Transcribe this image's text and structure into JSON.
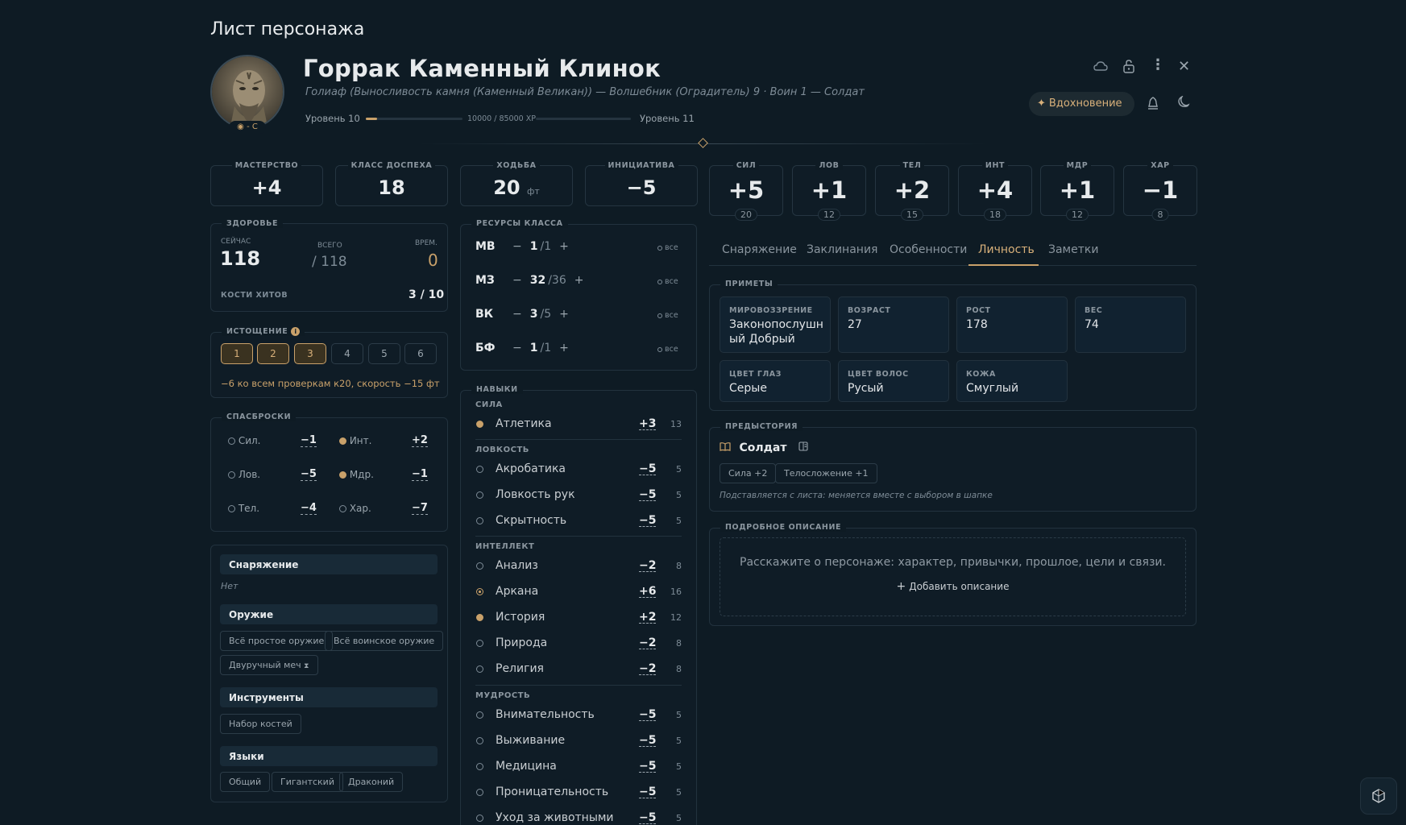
{
  "page_title": "Лист персонажа",
  "character": {
    "name": "Горрак Каменный Клинок",
    "subtitle": "Голиаф (Выносливость камня (Каменный Великан)) — Волшебник (Оградитель) 9 · Воин 1 — Солдат",
    "portrait_badge": "- С",
    "level_current": "Уровень 10",
    "level_next": "Уровень 11",
    "xp_text": "10000 / 85000 XP",
    "xp_progress": 0.118
  },
  "header_actions": {
    "inspiration_label": "Вдохновение"
  },
  "stats": [
    {
      "label": "МАСТЕРСТВО",
      "value": "+4",
      "unit": ""
    },
    {
      "label": "КЛАСС ДОСПЕХА",
      "value": "18",
      "unit": ""
    },
    {
      "label": "ХОДЬБА",
      "value": "20",
      "unit": "фт"
    },
    {
      "label": "ИНИЦИАТИВА",
      "value": "−5",
      "unit": ""
    }
  ],
  "abilities": [
    {
      "label": "СИЛ",
      "mod": "+5",
      "score": "20"
    },
    {
      "label": "ЛОВ",
      "mod": "+1",
      "score": "12"
    },
    {
      "label": "ТЕЛ",
      "mod": "+2",
      "score": "15"
    },
    {
      "label": "ИНТ",
      "mod": "+4",
      "score": "18"
    },
    {
      "label": "МДР",
      "mod": "+1",
      "score": "12"
    },
    {
      "label": "ХАР",
      "mod": "−1",
      "score": "8"
    }
  ],
  "health": {
    "title": "ЗДОРОВЬЕ",
    "current_label": "СЕЙЧАС",
    "current": "118",
    "total_label": "ВСЕГО",
    "total": "/ 118",
    "temp_label": "ВРЕМ.",
    "temp": "0",
    "hit_dice_label": "КОСТИ ХИТОВ",
    "hit_dice": "3 / 10"
  },
  "exhaustion": {
    "title": "ИСТОЩЕНИЕ",
    "levels": [
      "1",
      "2",
      "3",
      "4",
      "5",
      "6"
    ],
    "active_count": 3,
    "effect": "−6 ко всем проверкам к20, скорость −15 фт"
  },
  "saves": {
    "title": "СПАСБРОСКИ",
    "items": [
      {
        "label": "Сил.",
        "value": "−1",
        "proficient": false
      },
      {
        "label": "Инт.",
        "value": "+2",
        "proficient": true
      },
      {
        "label": "Лов.",
        "value": "−5",
        "proficient": false
      },
      {
        "label": "Мдр.",
        "value": "−1",
        "proficient": true
      },
      {
        "label": "Тел.",
        "value": "−4",
        "proficient": false
      },
      {
        "label": "Хар.",
        "value": "−7",
        "proficient": false
      }
    ]
  },
  "proficiencies": {
    "armor_title": "Снаряжение",
    "armor_value": "Нет",
    "weapons_title": "Оружие",
    "weapons": [
      "Всё простое оружие",
      "Всё воинское оружие",
      "Двуручный меч"
    ],
    "tools_title": "Инструменты",
    "tools": [
      "Набор костей"
    ],
    "languages_title": "Языки",
    "languages": [
      "Общий",
      "Гигантский",
      "Драконий"
    ]
  },
  "class_resources": {
    "title": "РЕСУРСЫ КЛАССА",
    "all_label": "все",
    "items": [
      {
        "name": "МВ",
        "current": "1",
        "max": "/1"
      },
      {
        "name": "МЗ",
        "current": "32",
        "max": "/36"
      },
      {
        "name": "ВК",
        "current": "3",
        "max": "/5"
      },
      {
        "name": "БФ",
        "current": "1",
        "max": "/1"
      }
    ]
  },
  "skills": {
    "title": "НАВЫКИ",
    "groups": {
      "str": "СИЛА",
      "dex": "ЛОВКОСТЬ",
      "int": "ИНТЕЛЛЕКТ",
      "wis": "МУДРОСТЬ"
    },
    "items": [
      {
        "name": "Атлетика",
        "mod": "+3",
        "passive": "13",
        "prof": "full"
      },
      {
        "name": "Акробатика",
        "mod": "−5",
        "passive": "5",
        "prof": "none"
      },
      {
        "name": "Ловкость рук",
        "mod": "−5",
        "passive": "5",
        "prof": "none"
      },
      {
        "name": "Скрытность",
        "mod": "−5",
        "passive": "5",
        "prof": "none"
      },
      {
        "name": "Анализ",
        "mod": "−2",
        "passive": "8",
        "prof": "none"
      },
      {
        "name": "Аркана",
        "mod": "+6",
        "passive": "16",
        "prof": "expert"
      },
      {
        "name": "История",
        "mod": "+2",
        "passive": "12",
        "prof": "full"
      },
      {
        "name": "Природа",
        "mod": "−2",
        "passive": "8",
        "prof": "none"
      },
      {
        "name": "Религия",
        "mod": "−2",
        "passive": "8",
        "prof": "none"
      },
      {
        "name": "Внимательность",
        "mod": "−5",
        "passive": "5",
        "prof": "none"
      },
      {
        "name": "Выживание",
        "mod": "−5",
        "passive": "5",
        "prof": "none"
      },
      {
        "name": "Медицина",
        "mod": "−5",
        "passive": "5",
        "prof": "none"
      },
      {
        "name": "Проницательность",
        "mod": "−5",
        "passive": "5",
        "prof": "none"
      },
      {
        "name": "Уход за животными",
        "mod": "−5",
        "passive": "5",
        "prof": "none"
      }
    ]
  },
  "tabs": [
    "Снаряжение",
    "Заклинания",
    "Особенности",
    "Личность",
    "Заметки"
  ],
  "active_tab": "Личность",
  "traits": {
    "title": "ПРИМЕТЫ",
    "items": [
      {
        "label": "МИРОВОЗЗРЕНИЕ",
        "value": "Законопослушн ый Добрый"
      },
      {
        "label": "ВОЗРАСТ",
        "value": "27"
      },
      {
        "label": "РОСТ",
        "value": "178"
      },
      {
        "label": "ВЕС",
        "value": "74"
      },
      {
        "label": "ЦВЕТ ГЛАЗ",
        "value": "Серые"
      },
      {
        "label": "ЦВЕТ ВОЛОС",
        "value": "Русый"
      },
      {
        "label": "КОЖА",
        "value": "Смуглый"
      }
    ]
  },
  "background": {
    "title": "ПРЕДЫСТОРИЯ",
    "name": "Солдат",
    "bonuses": [
      "Сила +2",
      "Телосложение +1"
    ],
    "note": "Подставляется с листа: меняется вместе с выбором в шапке"
  },
  "description": {
    "title": "ПОДРОБНОЕ ОПИСАНИЕ",
    "placeholder": "Расскажите о персонаже: характер, привычки, прошлое, цели и связи.",
    "add_label": "Добавить описание"
  },
  "colors": {
    "background": "#0e1b24",
    "accent": "#c9a16a",
    "panel_border": "#22323e"
  }
}
